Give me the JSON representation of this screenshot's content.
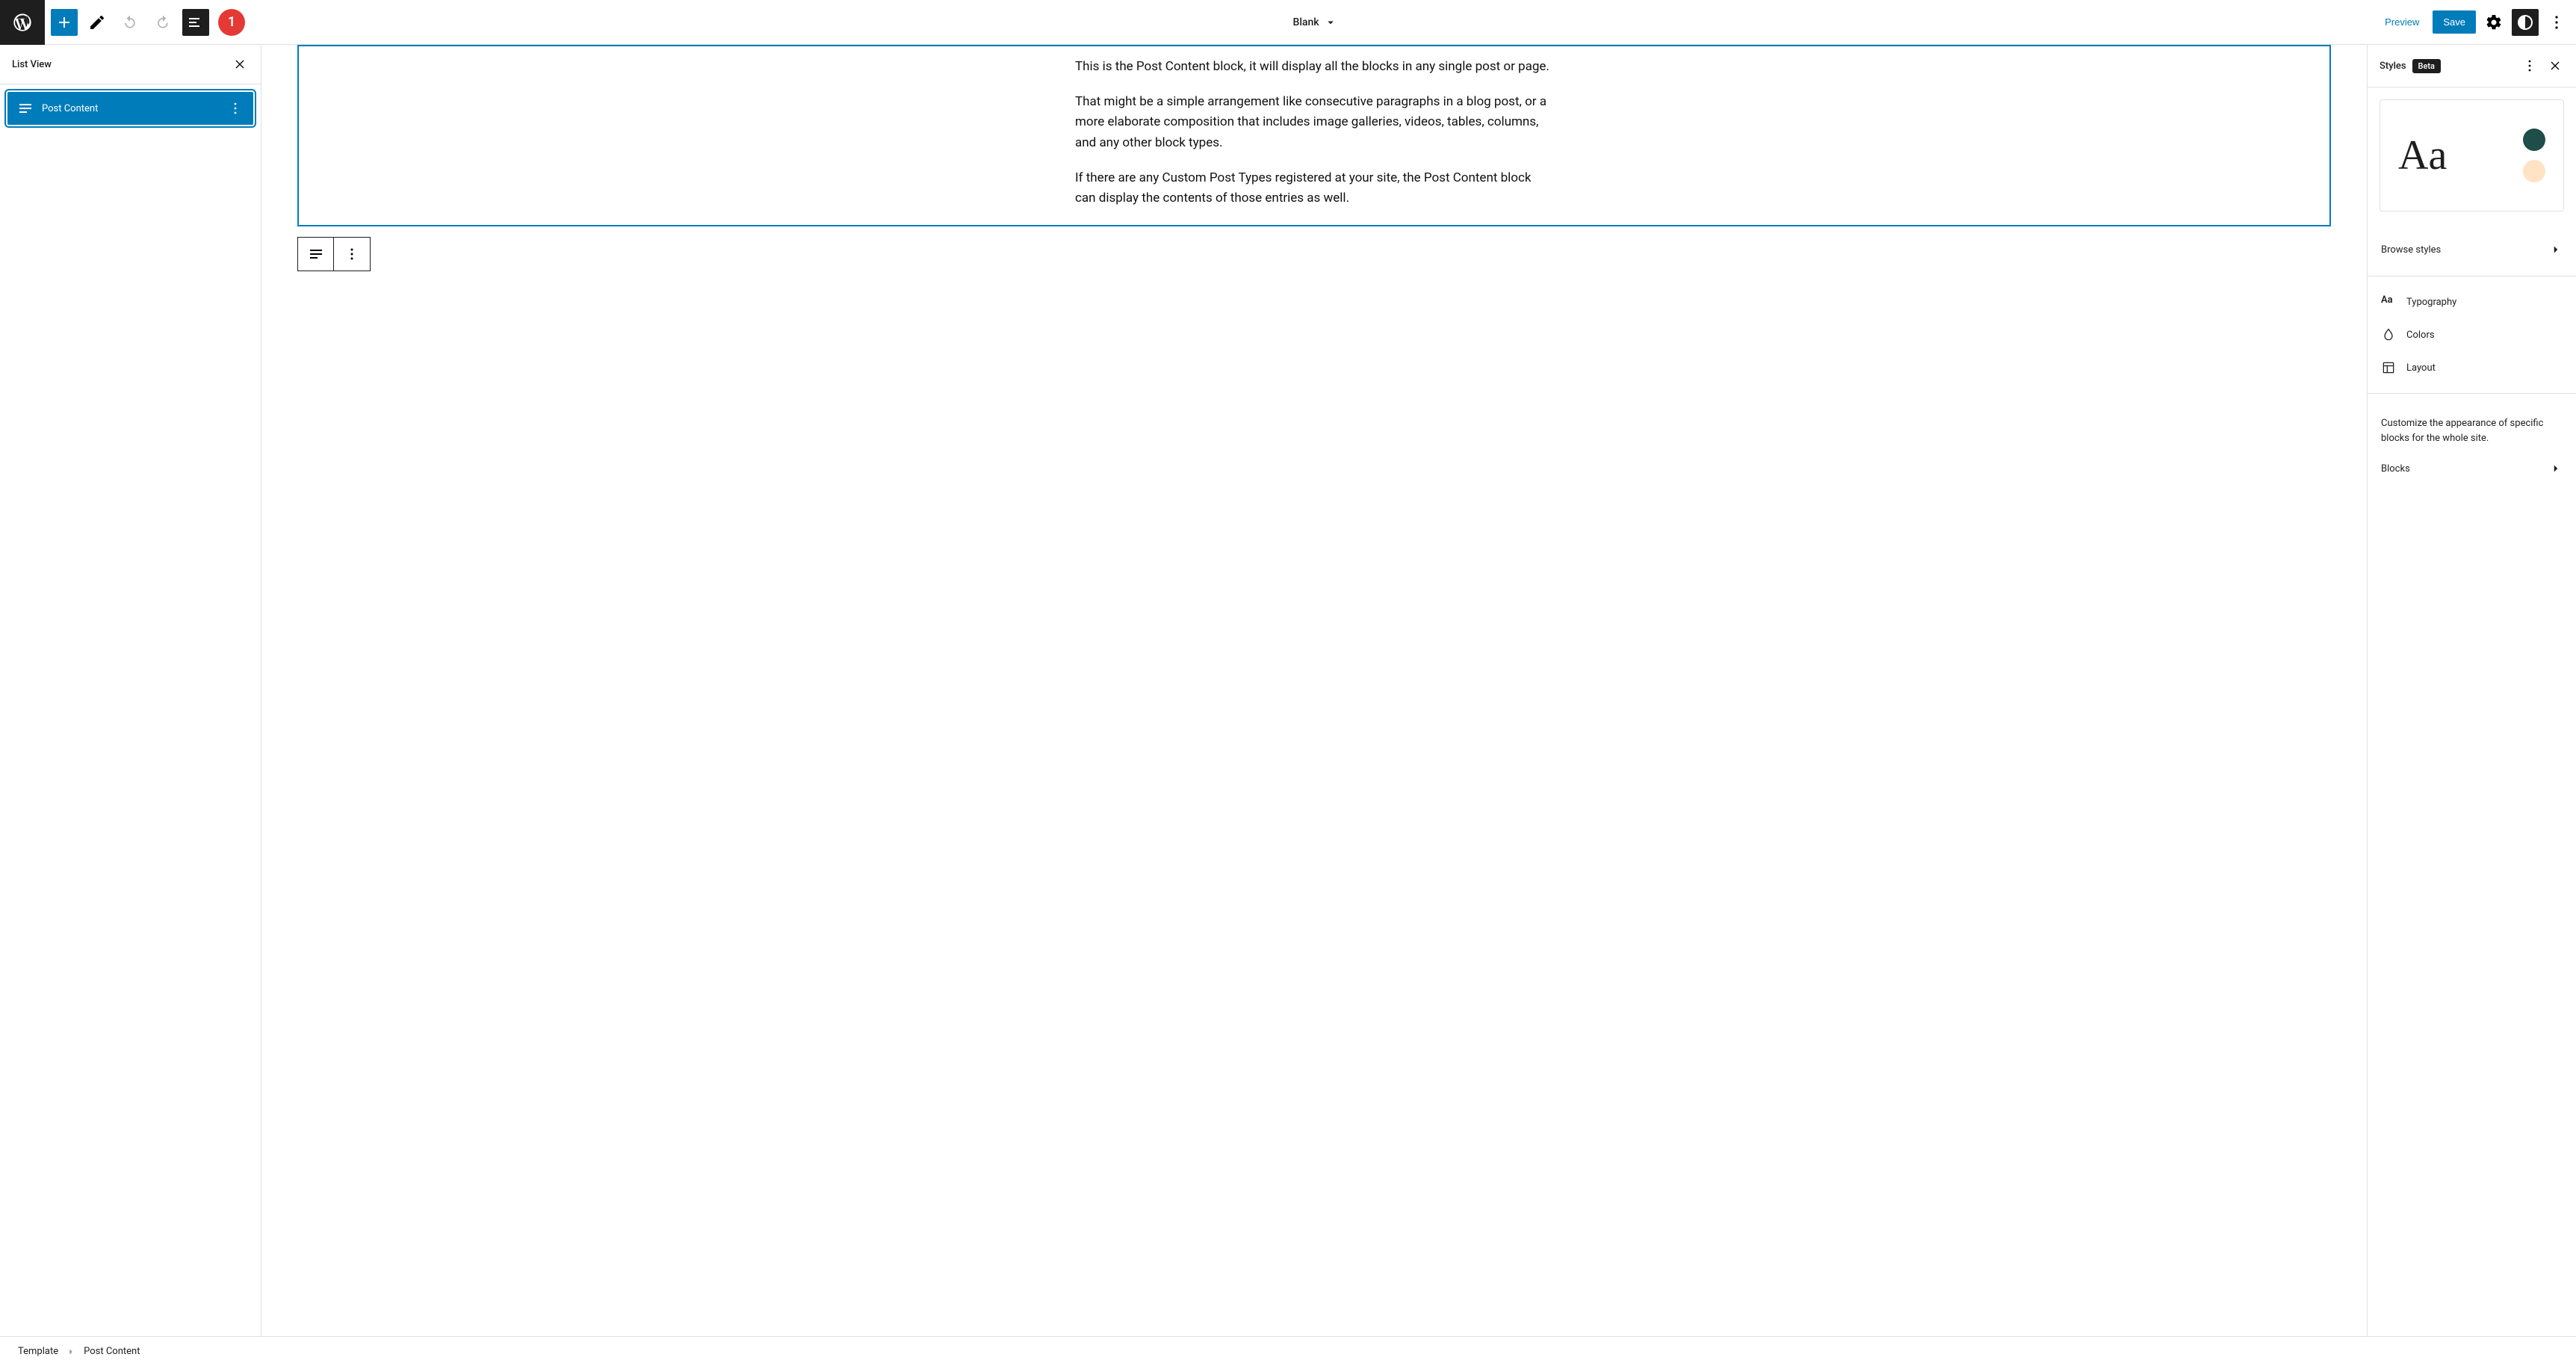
{
  "header": {
    "template_name": "Blank",
    "preview_label": "Preview",
    "save_label": "Save",
    "annotation_number": "1"
  },
  "list_view": {
    "title": "List View",
    "items": [
      {
        "label": "Post Content"
      }
    ]
  },
  "canvas": {
    "paragraphs": [
      "This is the Post Content block, it will display all the blocks in any single post or page.",
      "That might be a simple arrangement like consecutive paragraphs in a blog post, or a more elaborate composition that includes image galleries, videos, tables, columns, and any other block types.",
      "If there are any Custom Post Types registered at your site, the Post Content block can display the contents of those entries as well."
    ]
  },
  "styles_panel": {
    "title": "Styles",
    "badge": "Beta",
    "preview_text": "Aa",
    "browse_label": "Browse styles",
    "options": {
      "typography": "Typography",
      "colors": "Colors",
      "layout": "Layout"
    },
    "blocks_desc": "Customize the appearance of specific blocks for the whole site.",
    "blocks_label": "Blocks",
    "swatch_colors": {
      "dark": "#1e4d4a",
      "light": "#ffe3c4"
    }
  },
  "breadcrumb": {
    "root": "Template",
    "current": "Post Content"
  }
}
